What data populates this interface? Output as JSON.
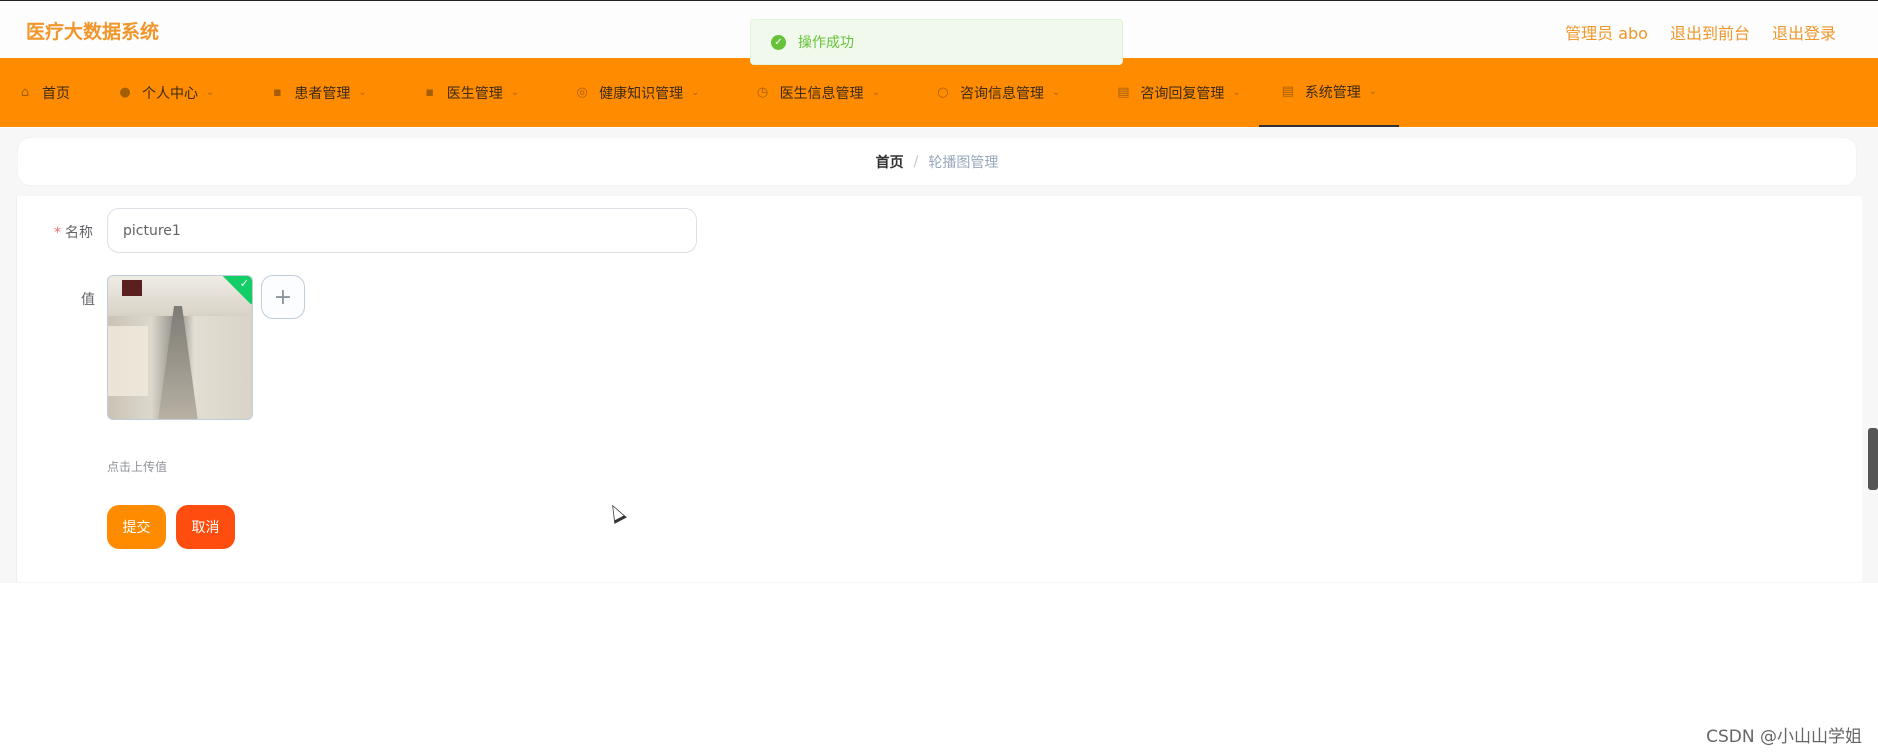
{
  "header": {
    "app_title": "医疗大数据系统",
    "admin_label": "管理员 abo",
    "exit_front_label": "退出到前台",
    "logout_label": "退出登录"
  },
  "toast": {
    "message": "操作成功",
    "icon": "check-circle-icon",
    "color": "#67c23a"
  },
  "nav": {
    "items": [
      {
        "label": "首页",
        "icon": "home-icon"
      },
      {
        "label": "个人中心",
        "icon": "user-icon"
      },
      {
        "label": "患者管理",
        "icon": "chat-icon"
      },
      {
        "label": "医生管理",
        "icon": "chat-icon"
      },
      {
        "label": "健康知识管理",
        "icon": "compass-icon"
      },
      {
        "label": "医生信息管理",
        "icon": "clock-icon"
      },
      {
        "label": "咨询信息管理",
        "icon": "circle-icon"
      },
      {
        "label": "咨询回复管理",
        "icon": "clipboard-icon"
      },
      {
        "label": "系统管理",
        "icon": "clipboard-icon"
      }
    ],
    "active_index": 8
  },
  "breadcrumb": {
    "home": "首页",
    "separator": "/",
    "current": "轮播图管理"
  },
  "form": {
    "name_label": "名称",
    "name_required_mark": "*",
    "name_value": "picture1",
    "value_label": "值",
    "upload_hint": "点击上传值",
    "submit_label": "提交",
    "cancel_label": "取消"
  },
  "watermark": "CSDN @小山山学姐",
  "colors": {
    "accent": "#ff8c00",
    "title": "#f0962a",
    "cancel": "#ff4d0f",
    "success": "#67c23a"
  }
}
